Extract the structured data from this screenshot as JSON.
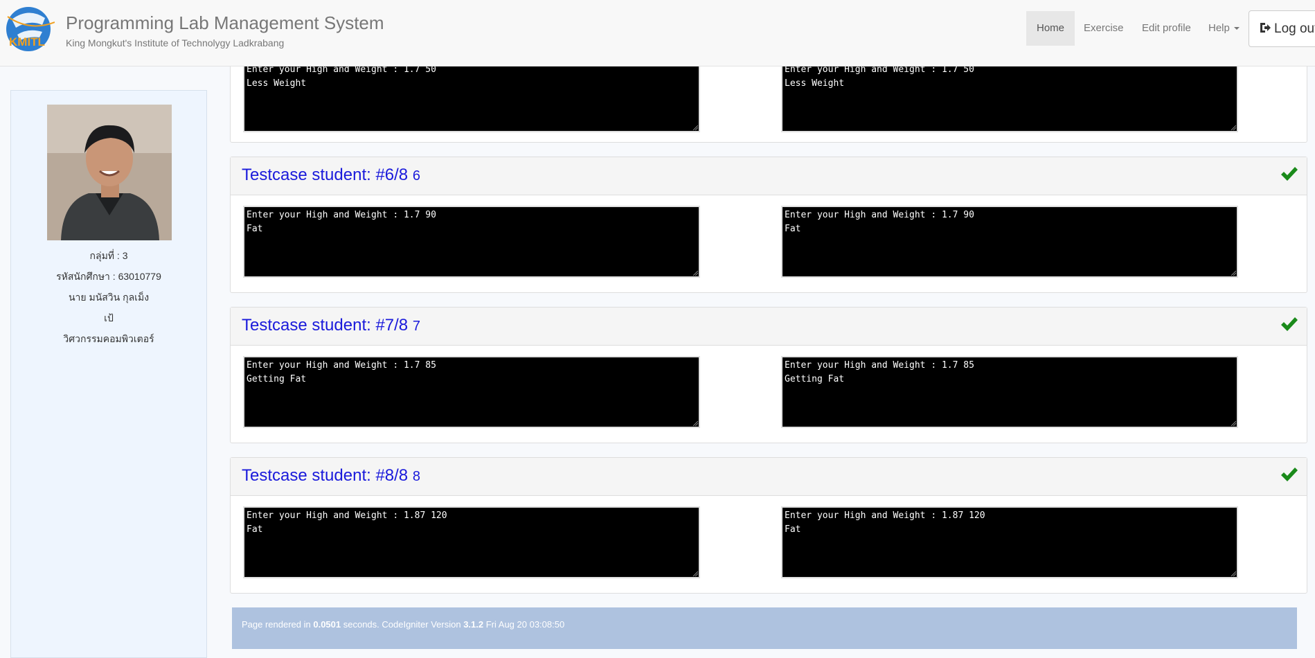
{
  "navbar": {
    "brand_title": "Programming Lab Management System",
    "brand_subtitle": "King Mongkut's Institute of Technolygy Ladkrabang",
    "logo_text": "KMITL",
    "items": [
      {
        "label": "Home",
        "active": true
      },
      {
        "label": "Exercise"
      },
      {
        "label": "Edit profile"
      },
      {
        "label": "Help"
      }
    ],
    "logout_label": "Log out"
  },
  "sidebar": {
    "group": "กลุ่มที่ : 3",
    "student_id": "รหัสนักศึกษา : 63010779",
    "name": "นาย มนัสวิน กุลเม็ง",
    "nickname": "เป้",
    "department": "วิศวกรรมคอมพิวเตอร์"
  },
  "testcases": [
    {
      "title": "",
      "student_output": "Enter your High and Weight : 1.7 50\nLess Weight",
      "expected_output": "Enter your High and Weight : 1.7 50\nLess Weight",
      "passed": true
    },
    {
      "title": "Testcase student: #6/8",
      "number": "6",
      "student_output": "Enter your High and Weight : 1.7 90\nFat",
      "expected_output": "Enter your High and Weight : 1.7 90\nFat",
      "passed": true
    },
    {
      "title": "Testcase student: #7/8",
      "number": "7",
      "student_output": "Enter your High and Weight : 1.7 85\nGetting Fat",
      "expected_output": "Enter your High and Weight : 1.7 85\nGetting Fat",
      "passed": true
    },
    {
      "title": "Testcase student: #8/8",
      "number": "8",
      "student_output": "Enter your High and Weight : 1.87 120\nFat",
      "expected_output": "Enter your High and Weight : 1.87 120\nFat",
      "passed": true
    }
  ],
  "footer": {
    "prefix": "Page rendered in ",
    "seconds": "0.0501",
    "middle": " seconds. CodeIgniter Version ",
    "version": "3.1.2",
    "date": " Fri Aug 20 03:08:50"
  },
  "colors": {
    "title_blue": "#1a1adb",
    "check_green": "#1a8a1a",
    "footer_bg": "#aec2df",
    "console_bg": "#000000"
  }
}
